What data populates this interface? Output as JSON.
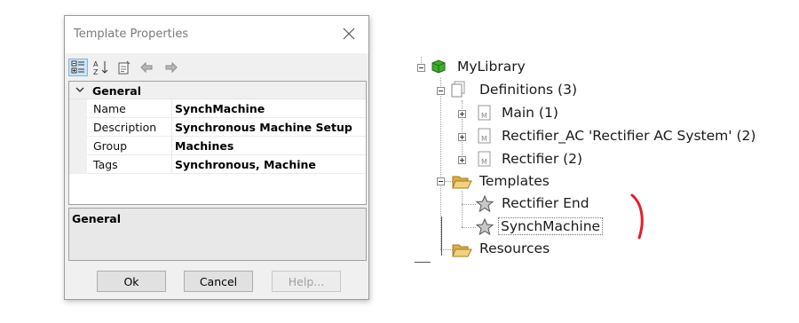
{
  "dialog": {
    "title": "Template Properties",
    "category": "General",
    "properties": [
      {
        "name": "Name",
        "value": "SynchMachine"
      },
      {
        "name": "Description",
        "value": "Synchronous Machine Setup"
      },
      {
        "name": "Group",
        "value": "Machines"
      },
      {
        "name": "Tags",
        "value": "Synchronous, Machine"
      }
    ],
    "description_title": "General",
    "buttons": {
      "ok": "Ok",
      "cancel": "Cancel",
      "help": "Help..."
    },
    "toolbar_icons": [
      "categorized-icon",
      "alphabetical-sort-icon",
      "property-pages-icon",
      "back-icon",
      "forward-icon"
    ]
  },
  "tree": {
    "root": "MyLibrary",
    "definitions": "Definitions (3)",
    "definition_items": [
      "Main (1)",
      "Rectifier_AC 'Rectifier AC System' (2)",
      "Rectifier (2)"
    ],
    "templates": "Templates",
    "template_items": [
      "Rectifier End",
      "SynchMachine"
    ],
    "resources": "Resources",
    "selected_item": "SynchMachine"
  },
  "colors": {
    "library_icon": "#3fae2a",
    "folder_icon": "#e8c46a",
    "annotation_mark": "#e0202a",
    "selection_highlight": "#cce4f7"
  }
}
